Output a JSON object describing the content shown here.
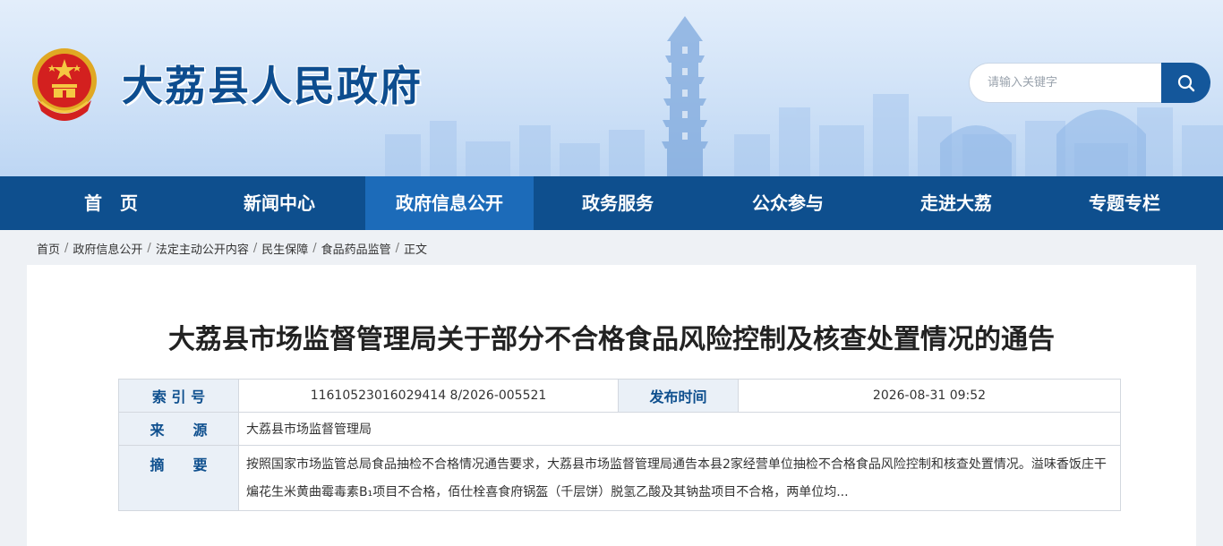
{
  "site": {
    "name": "大荔县人民政府"
  },
  "search": {
    "placeholder": "请输入关键字"
  },
  "nav": {
    "items": [
      {
        "label": "首　页"
      },
      {
        "label": "新闻中心"
      },
      {
        "label": "政府信息公开",
        "active": true
      },
      {
        "label": "政务服务"
      },
      {
        "label": "公众参与"
      },
      {
        "label": "走进大荔"
      },
      {
        "label": "专题专栏"
      }
    ]
  },
  "breadcrumb": {
    "items": [
      "首页",
      "政府信息公开",
      "法定主动公开内容",
      "民生保障",
      "食品药品监管",
      "正文"
    ],
    "separator": "/"
  },
  "article": {
    "title": "大荔县市场监督管理局关于部分不合格食品风险控制及核查处置情况的通告",
    "meta": {
      "index_label": "索 引 号",
      "index_value": "11610523016029414 8/2026-005521",
      "date_label": "发布时间",
      "date_value": "2026-08-31 09:52",
      "source_label": "来　　源",
      "source_value": "大荔县市场监督管理局",
      "summary_label": "摘　　要",
      "summary_value": "按照国家市场监管总局食品抽检不合格情况通告要求，大荔县市场监督管理局通告本县2家经营单位抽检不合格食品风险控制和核查处置情况。溢味香饭庄干煸花生米黄曲霉毒素B₁项目不合格，佰仕栓喜食府锅盔（千层饼）脱氢乙酸及其钠盐项目不合格，两单位均..."
    }
  },
  "colors": {
    "nav_bg": "#0e4f8e",
    "nav_active": "#1c6bb9",
    "title_blue": "#0d4d8f",
    "search_btn": "#14579b"
  },
  "icons": {
    "search": "search-icon",
    "emblem": "national-emblem-icon"
  }
}
